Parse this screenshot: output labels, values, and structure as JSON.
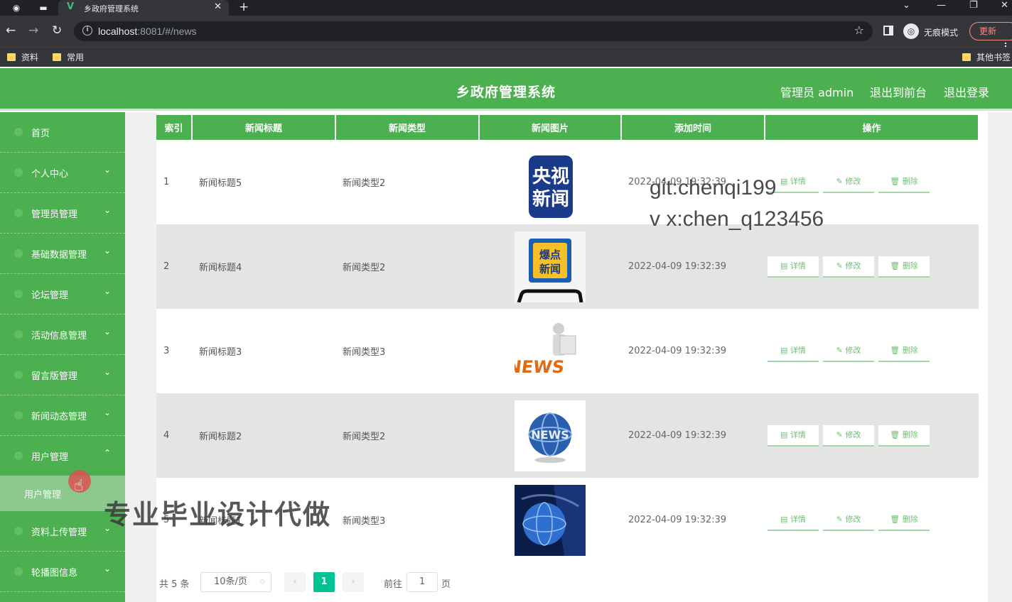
{
  "browser": {
    "tab_title": "乡政府管理系统",
    "tab_favicon": "V",
    "url_host": "localhost",
    "url_rest": ":8081/#/news",
    "incognito_label": "无痕模式",
    "update_label": "更新",
    "bookmarks": [
      "资料",
      "常用"
    ],
    "other_bookmarks": "其他书签"
  },
  "header": {
    "title": "乡政府管理系统",
    "user": "管理员 admin",
    "front": "退出到前台",
    "logout": "退出登录"
  },
  "sidebar": {
    "items": [
      {
        "label": "首页",
        "arrow": ""
      },
      {
        "label": "个人中心",
        "arrow": "⌄"
      },
      {
        "label": "管理员管理",
        "arrow": "⌄"
      },
      {
        "label": "基础数据管理",
        "arrow": "⌄"
      },
      {
        "label": "论坛管理",
        "arrow": "⌄"
      },
      {
        "label": "活动信息管理",
        "arrow": "⌄"
      },
      {
        "label": "留言版管理",
        "arrow": "⌄"
      },
      {
        "label": "新闻动态管理",
        "arrow": "⌄"
      },
      {
        "label": "用户管理",
        "arrow": "⌃"
      },
      {
        "label": "资料上传管理",
        "arrow": "⌄"
      },
      {
        "label": "轮播图信息",
        "arrow": "⌄"
      }
    ],
    "submenu_label": "用户管理"
  },
  "table": {
    "headers": [
      "索引",
      "新闻标题",
      "新闻类型",
      "新闻图片",
      "添加时间",
      "操作"
    ],
    "rows": [
      {
        "index": "1",
        "title": "新闻标题5",
        "type": "新闻类型2",
        "time": "2022-04-09 19:32:39",
        "image": "cctv-news-logo"
      },
      {
        "index": "2",
        "title": "新闻标题4",
        "type": "新闻类型2",
        "time": "2022-04-09 19:32:39",
        "image": "hot-news-phone"
      },
      {
        "index": "3",
        "title": "新闻标题3",
        "type": "新闻类型3",
        "time": "2022-04-09 19:32:39",
        "image": "news-3d-figure"
      },
      {
        "index": "4",
        "title": "新闻标题2",
        "type": "新闻类型2",
        "time": "2022-04-09 19:32:39",
        "image": "news-globe"
      },
      {
        "index": "5",
        "title": "新闻标题1",
        "type": "新闻类型3",
        "time": "2022-04-09 19:32:39",
        "image": "blue-globe"
      }
    ],
    "actions": {
      "detail": "详情",
      "edit": "修改",
      "delete": "删除"
    }
  },
  "pagination": {
    "total": "共 5 条",
    "page_size": "10条/页",
    "current_page": "1",
    "goto_label": "前往",
    "goto_value": "1",
    "goto_unit": "页"
  },
  "watermarks": {
    "git": "git:chenqi199",
    "vx": "v x:chen_q123456",
    "ad": "专业毕业设计代做"
  },
  "colors": {
    "primary_green": "#4caf50",
    "active_page": "#00c292",
    "row_alt": "#e4e4e4"
  }
}
